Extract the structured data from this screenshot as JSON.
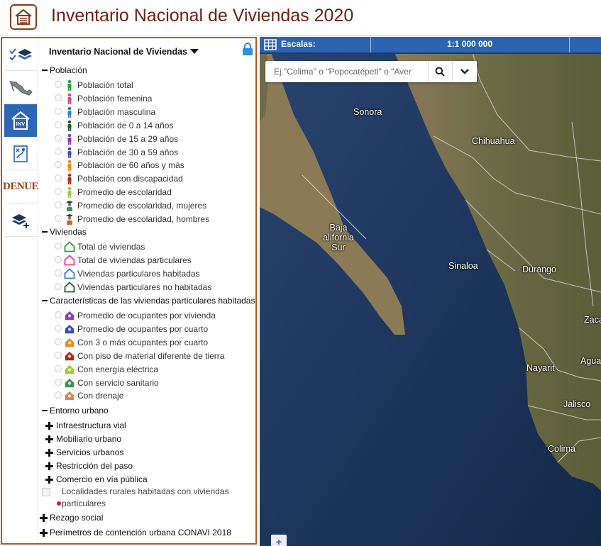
{
  "app": {
    "title": "Inventario Nacional de Viviendas 2020"
  },
  "sidebar": {
    "items": [
      {
        "icon": "layers-check-icon",
        "active": false
      },
      {
        "icon": "mexico-map-icon",
        "active": false
      },
      {
        "icon": "inv-house-icon",
        "label": "INV",
        "active": true
      },
      {
        "icon": "map-route-icon",
        "active": false
      },
      {
        "icon": "denue-logo",
        "label": "DENUE",
        "active": false
      },
      {
        "icon": "add-layer-icon",
        "active": false
      }
    ]
  },
  "tree": {
    "title": "Inventario Nacional de Viviendas",
    "groups": [
      {
        "label": "Población",
        "items": [
          {
            "label": "Población total",
            "icon": "person-icon",
            "color": "#2e9a3c"
          },
          {
            "label": "Población femenina",
            "icon": "person-icon",
            "color": "#e0418f"
          },
          {
            "label": "Población masculina",
            "icon": "person-icon",
            "color": "#2c7fd0"
          },
          {
            "label": "Población de 0 a 14 años",
            "icon": "person-icon",
            "color": "#1f5e2b"
          },
          {
            "label": "Población de 15 a 29 años",
            "icon": "person-icon",
            "color": "#8a3fae"
          },
          {
            "label": "Población de 30 a 59 años",
            "icon": "person-icon",
            "color": "#3a4fb0"
          },
          {
            "label": "Población de 60 años y más",
            "icon": "person-icon",
            "color": "#f08a1c"
          },
          {
            "label": "Población con discapacidad",
            "icon": "person-icon",
            "color": "#b52418"
          },
          {
            "label": "Promedio de escolaridad",
            "icon": "person-icon",
            "color": "#a6c43a"
          },
          {
            "label": "Promedio de escolaridad, mujeres",
            "icon": "graduate-icon",
            "color": "#3e8f5a"
          },
          {
            "label": "Promedio de escolaridad, hombres",
            "icon": "graduate-icon",
            "color": "#b4703a"
          }
        ]
      },
      {
        "label": "Viviendas",
        "items": [
          {
            "label": "Total de viviendas",
            "icon": "house-outline-icon",
            "color": "#2e9a3c"
          },
          {
            "label": "Total de viviendas particulares",
            "icon": "house-outline-icon",
            "color": "#e0418f"
          },
          {
            "label": "Viviendas particulares habitadas",
            "icon": "house-outline-icon",
            "color": "#2c7fd0"
          },
          {
            "label": "Viviendas particulares no habitadas",
            "icon": "house-outline-icon",
            "color": "#1f5e2b"
          }
        ]
      },
      {
        "label": "Características de las viviendas particulares habitadas",
        "items": [
          {
            "label": "Promedio de ocupantes por vivienda",
            "icon": "house-filled-icon",
            "color": "#8a3fae"
          },
          {
            "label": "Promedio de ocupantes por cuarto",
            "icon": "house-filled-icon",
            "color": "#3a4fb0"
          },
          {
            "label": "Con 3 o más ocupantes por cuarto",
            "icon": "house-filled-icon",
            "color": "#f08a1c"
          },
          {
            "label": "Con piso de material diferente de tierra",
            "icon": "house-filled-icon",
            "color": "#b52418"
          },
          {
            "label": "Con energía eléctrica",
            "icon": "house-filled-icon",
            "color": "#a6c43a"
          },
          {
            "label": "Con servicio sanitario",
            "icon": "house-filled-icon",
            "color": "#3e8f5a"
          },
          {
            "label": "Con drenaje",
            "icon": "house-filled-icon",
            "color": "#c98a55"
          }
        ]
      },
      {
        "label": "Entorno urbano",
        "subitems": [
          {
            "label": "Infraestructura vial"
          },
          {
            "label": "Mobiliario urbano"
          },
          {
            "label": "Servicios urbanos"
          },
          {
            "label": "Restricción del paso"
          },
          {
            "label": "Comercio en vía pública"
          }
        ],
        "localidades": {
          "line1": "Localidades rurales habitadas con viviendas",
          "line2": "particulares"
        }
      }
    ],
    "collapsed": [
      {
        "label": "Rezago social"
      },
      {
        "label": "Perímetros de contención urbana CONAVI 2018"
      }
    ]
  },
  "map": {
    "scale_label": "Escalas:",
    "scale_value": "1:1 000 000",
    "search_placeholder": "Ej.\"Colima\" o \"Popocatépetl\" o \"Aver",
    "zoom_label": "+",
    "cities": [
      {
        "name": "Sonora"
      },
      {
        "name": "Chihuahua"
      },
      {
        "name": "Baja alifornia Sur"
      },
      {
        "name": "Sinaloa"
      },
      {
        "name": "Durango"
      },
      {
        "name": "Nayarit"
      },
      {
        "name": "Jalisco"
      },
      {
        "name": "Colima"
      },
      {
        "name": "Zaca"
      },
      {
        "name": "Agua"
      }
    ]
  },
  "colors": {
    "brand": "#6b1f12",
    "panel_border": "#b4581f",
    "accent_blue": "#2b64b1"
  }
}
